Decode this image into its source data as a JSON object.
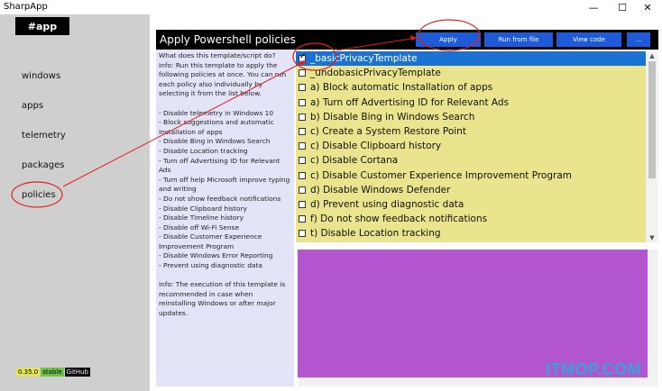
{
  "window": {
    "title": "SharpApp",
    "controls": {
      "minimize": "—",
      "maximize": "☐",
      "close": "✕"
    }
  },
  "sidebar": {
    "badge": "#app",
    "items": [
      {
        "label": "windows"
      },
      {
        "label": "apps"
      },
      {
        "label": "telemetry"
      },
      {
        "label": "packages"
      },
      {
        "label": "policies"
      }
    ],
    "version": "0.35.0",
    "channel": "stable",
    "github": "GitHub"
  },
  "header": {
    "title": "Apply Powershell policies",
    "buttons": {
      "apply": "Apply",
      "run_from_file": "Run from file",
      "view_code": "View code",
      "more": "..."
    }
  },
  "description": "What does this template/script do?\n Info: Run this template to apply the following policies at once. You can run each policy also individually by selecting it from the list below.\n\n- Disable telemetry in Windows 10\n- Block suggestions and automatic Installation of apps\n- Disable Bing in Windows Search\n- Disable Location tracking\n- Turn off Advertising ID for Relevant Ads\n- Turn off help Microsoft improve typing and writing\n- Do not show feedback notifications\n- Disable Clipboard history\n- Disable Timeline history\n- Disable off Wi-Fi Sense\n- Disable Customer Experience Improvement Program\n- Disable Windows Error Reporting\n- Prevent using diagnostic data\n\n Info: The execution of this template is recommended in case when reinstalling Windows or after major updates.",
  "policies": [
    {
      "label": "_basicPrivacyTemplate",
      "checked": true,
      "selected": true
    },
    {
      "label": "_undobasicPrivacyTemplate",
      "checked": false
    },
    {
      "label": "a) Block automatic Installation of apps",
      "checked": false
    },
    {
      "label": "a) Turn off Advertising ID for Relevant Ads",
      "checked": false
    },
    {
      "label": "b) Disable Bing in Windows Search",
      "checked": false
    },
    {
      "label": "c) Create a System Restore Point",
      "checked": false
    },
    {
      "label": "c) Disable Clipboard history",
      "checked": false
    },
    {
      "label": "c) Disable Cortana",
      "checked": false
    },
    {
      "label": "c) Disable Customer Experience Improvement Program",
      "checked": false
    },
    {
      "label": "d) Disable Windows Defender",
      "checked": false
    },
    {
      "label": "d) Prevent using diagnostic data",
      "checked": false
    },
    {
      "label": "f) Do not show feedback notifications",
      "checked": false
    },
    {
      "label": "t) Disable Location tracking",
      "checked": false
    }
  ],
  "scroll": {
    "up": "▲",
    "down": "▼"
  },
  "watermark": "ITMOP.COM",
  "colors": {
    "sidebar": "#cfcfcf",
    "accent_button": "#1f5ad8",
    "selected_item": "#1a72d4",
    "list_background": "#e9e48d",
    "description_background": "#e3e4f8",
    "output_background": "#b455d0",
    "annotation": "#e02020"
  }
}
